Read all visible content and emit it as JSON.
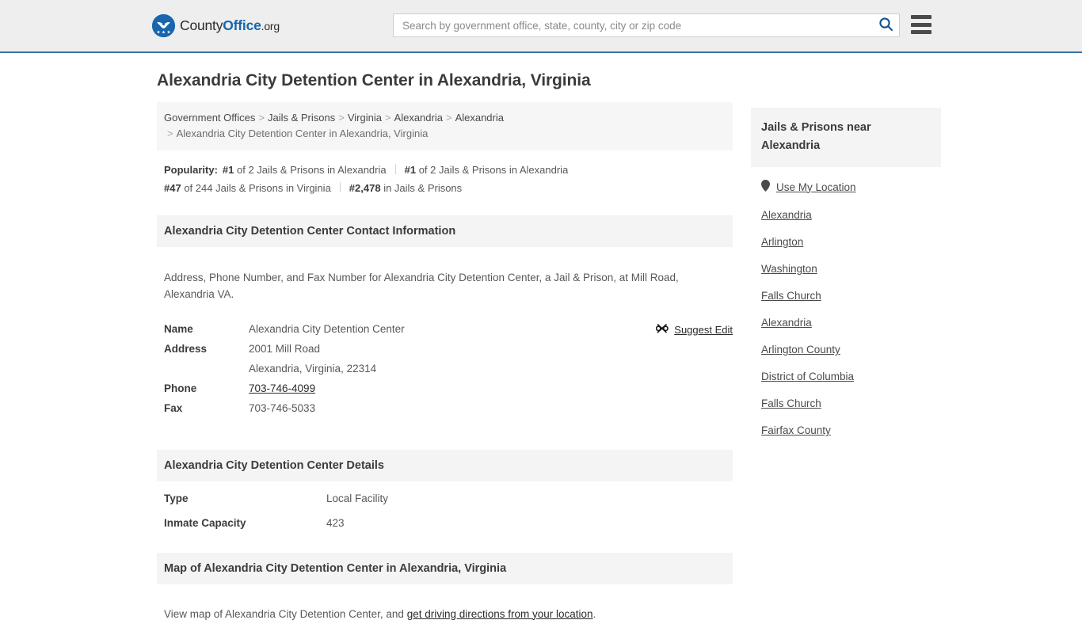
{
  "header": {
    "logo": {
      "part1": "County",
      "part2": "Office",
      "part3": ".org",
      "icon": "eagle-shield-logo-icon"
    },
    "search": {
      "placeholder": "Search by government office, state, county, city or zip code",
      "value": "",
      "icon": "search-icon"
    },
    "menu_icon": "hamburger-menu-icon",
    "accent_color": "#1766ae",
    "border_color": "#3a73a8",
    "background": "#eeeeee"
  },
  "page_title": "Alexandria City Detention Center in Alexandria, Virginia",
  "breadcrumb": {
    "items": [
      "Government Offices",
      "Jails & Prisons",
      "Virginia",
      "Alexandria",
      "Alexandria"
    ],
    "current": "Alexandria City Detention Center in Alexandria, Virginia",
    "separator": ">"
  },
  "popularity": {
    "label": "Popularity:",
    "items": [
      {
        "rank": "#1",
        "rest": "of 2 Jails & Prisons in Alexandria"
      },
      {
        "rank": "#1",
        "rest": "of 2 Jails & Prisons in Alexandria"
      },
      {
        "rank": "#47",
        "rest": "of 244 Jails & Prisons in Virginia"
      },
      {
        "rank": "#2,478",
        "rest": "in Jails & Prisons"
      }
    ]
  },
  "contact": {
    "heading": "Alexandria City Detention Center Contact Information",
    "intro": "Address, Phone Number, and Fax Number for Alexandria City Detention Center, a Jail & Prison, at Mill Road, Alexandria VA.",
    "suggest_edit": {
      "label": "Suggest Edit",
      "icon": "suggest-edit-icon"
    },
    "rows": [
      {
        "key": "Name",
        "value": "Alexandria City Detention Center"
      },
      {
        "key": "Address",
        "value": "2001 Mill Road"
      },
      {
        "key": "",
        "value": "Alexandria, Virginia, 22314"
      },
      {
        "key": "Phone",
        "value": "703-746-4099"
      },
      {
        "key": "Fax",
        "value": "703-746-5033"
      }
    ]
  },
  "details": {
    "heading": "Alexandria City Detention Center Details",
    "rows": [
      {
        "key": "Type",
        "value": "Local Facility"
      },
      {
        "key": "Inmate Capacity",
        "value": "423"
      }
    ]
  },
  "map": {
    "heading": "Map of Alexandria City Detention Center in Alexandria, Virginia",
    "note_prefix": "View map of Alexandria City Detention Center, and ",
    "note_link": "get driving directions from your location",
    "note_suffix": "."
  },
  "sidebar": {
    "heading": "Jails & Prisons near Alexandria",
    "use_my_location": {
      "label": "Use My Location",
      "icon": "map-pin-icon"
    },
    "links": [
      "Alexandria",
      "Arlington",
      "Washington",
      "Falls Church",
      "Alexandria",
      "Arlington County",
      "District of Columbia",
      "Falls Church",
      "Fairfax County"
    ]
  }
}
